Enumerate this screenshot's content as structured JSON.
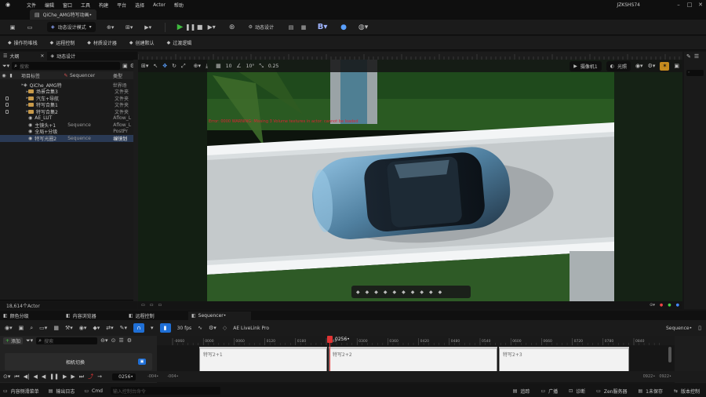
{
  "menubar": {
    "items": [
      "文件",
      "编辑",
      "窗口",
      "工具",
      "构建",
      "平台",
      "选择",
      "Actor",
      "帮助"
    ],
    "user": "JZKSHS74"
  },
  "tab": {
    "title": "QiChe_AMG特写动画•"
  },
  "toolbar": {
    "mode_label": "动态设计模式",
    "motion_design_label": "动态设计"
  },
  "modebar": {
    "items": [
      "操作符堆栈",
      "运程控制",
      "材质设计器",
      "创建默认",
      "过渡逻辑"
    ]
  },
  "outliner": {
    "tabs": [
      "大纲",
      "动态设计"
    ],
    "search_placeholder": "搜索",
    "col_item": "项目标签",
    "col_seq": "Sequencer",
    "col_type": "类型",
    "rows": [
      {
        "label": "QiChe_AMG特",
        "seq": "",
        "type": "世界场"
      },
      {
        "label": "场景合集3",
        "seq": "",
        "type": "文件夹"
      },
      {
        "label": "汽车+导航",
        "seq": "",
        "type": "文件夹"
      },
      {
        "label": "特写合集1",
        "seq": "",
        "type": "文件夹"
      },
      {
        "label": "特写合集2",
        "seq": "",
        "type": "文件夹"
      },
      {
        "label": "AE_LUT",
        "seq": "",
        "type": "Aflow_L"
      },
      {
        "label": "主镜头+1",
        "seq": "Sequence",
        "type": "Aflow_L"
      },
      {
        "label": "全局+分级",
        "seq": "",
        "type": "PostPr"
      },
      {
        "label": "特写光圈2",
        "seq": "Sequence",
        "type": "编镜划"
      }
    ],
    "count": "18,614个Actor"
  },
  "viewport": {
    "camera_label": "摄像机1",
    "lit_label": "光照",
    "snap_angle": "10°",
    "snap_grid": "10",
    "scale_snap": "0.25",
    "warning": "Error: 0000 WARNING: Missing 3 Volume textures in actor: cannot be loaded"
  },
  "bottom_tabs": [
    "颜色分级",
    "内容浏览器",
    "远程控制",
    "Sequencer•"
  ],
  "sequencer": {
    "fps": "30 fps",
    "livelink": "AE LiveLink Pro",
    "sequence_name": "Sequence•",
    "add_label": "添加",
    "search_placeholder": "搜索",
    "track_label": "相机切换",
    "playhead_label": "0256•",
    "current_frame": "0256•",
    "ruler_labels": [
      "-0060",
      "0000",
      "0060",
      "0120",
      "0180",
      "0240",
      "0300",
      "0360",
      "0420",
      "0480",
      "0540",
      "0600",
      "0660",
      "0720",
      "0780",
      "0840"
    ],
    "sections": [
      "特写2+1",
      "特写2+2",
      "特写2+3"
    ],
    "range_start": "-004•",
    "range_start2": "-004•",
    "range_end": "0922•",
    "range_end2": "0922•"
  },
  "statusbar": {
    "content_drawer": "内容侧滑菜单",
    "output_log": "输出日志",
    "cmd": "Cmd",
    "console_placeholder": "输入控制台命令",
    "trace": "追踪",
    "broadcast": "广播",
    "diagnose": "诊断",
    "zen": "Zen服务器",
    "unsaved": "1未保存",
    "version": "版本控制"
  },
  "colors": {
    "play_green": "#3fba3f",
    "accent_blue": "#1f6fd6",
    "playhead_red": "#e03434",
    "folder": "#c89a4a"
  }
}
